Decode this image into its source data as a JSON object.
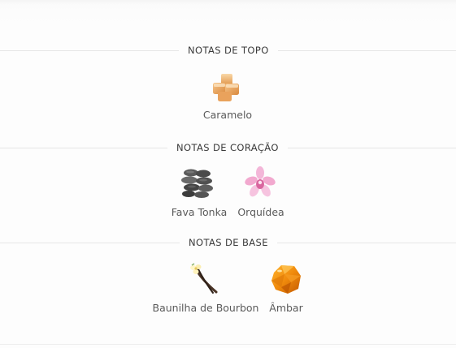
{
  "sections": [
    {
      "title": "NOTAS DE TOPO",
      "notes": [
        {
          "name": "Caramelo",
          "icon": "caramel-icon"
        }
      ]
    },
    {
      "title": "NOTAS DE CORAÇÃO",
      "notes": [
        {
          "name": "Fava Tonka",
          "icon": "tonka-bean-icon"
        },
        {
          "name": "Orquídea",
          "icon": "orchid-icon"
        }
      ]
    },
    {
      "title": "NOTAS DE BASE",
      "notes": [
        {
          "name": "Baunilha de Bourbon",
          "icon": "vanilla-icon"
        },
        {
          "name": "Âmbar",
          "icon": "amber-icon"
        }
      ]
    }
  ]
}
